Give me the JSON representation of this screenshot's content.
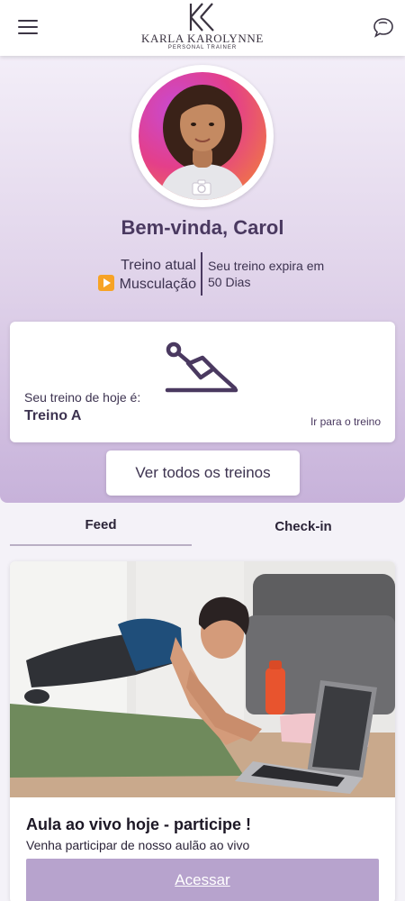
{
  "header": {
    "logo_name": "KARLA KAROLYNNE",
    "logo_subtitle": "PERSONAL TRAINER",
    "menu_icon": "hamburger-menu-icon",
    "chat_icon": "chat-bubbles-icon"
  },
  "profile": {
    "welcome": "Bem-vinda, Carol",
    "current_label": "Treino atual",
    "current_workout": "Musculação",
    "expiry_line1": "Seu treino expira em",
    "expiry_line2": "50 Dias"
  },
  "today": {
    "label": "Seu treino de hoje é:",
    "workout": "Treino A",
    "link": "Ir para o treino"
  },
  "all_button": "Ver todos os treinos",
  "tabs": [
    {
      "label": "Feed",
      "active": true
    },
    {
      "label": "Check-in",
      "active": false
    }
  ],
  "post": {
    "title": "Aula ao vivo hoje - participe !",
    "description": "Venha participar de nosso aulão ao vivo",
    "button": "Acessar"
  },
  "colors": {
    "primary": "#4a3960",
    "accent_button": "#b7a3cd",
    "play_badge": "#f7a325"
  }
}
